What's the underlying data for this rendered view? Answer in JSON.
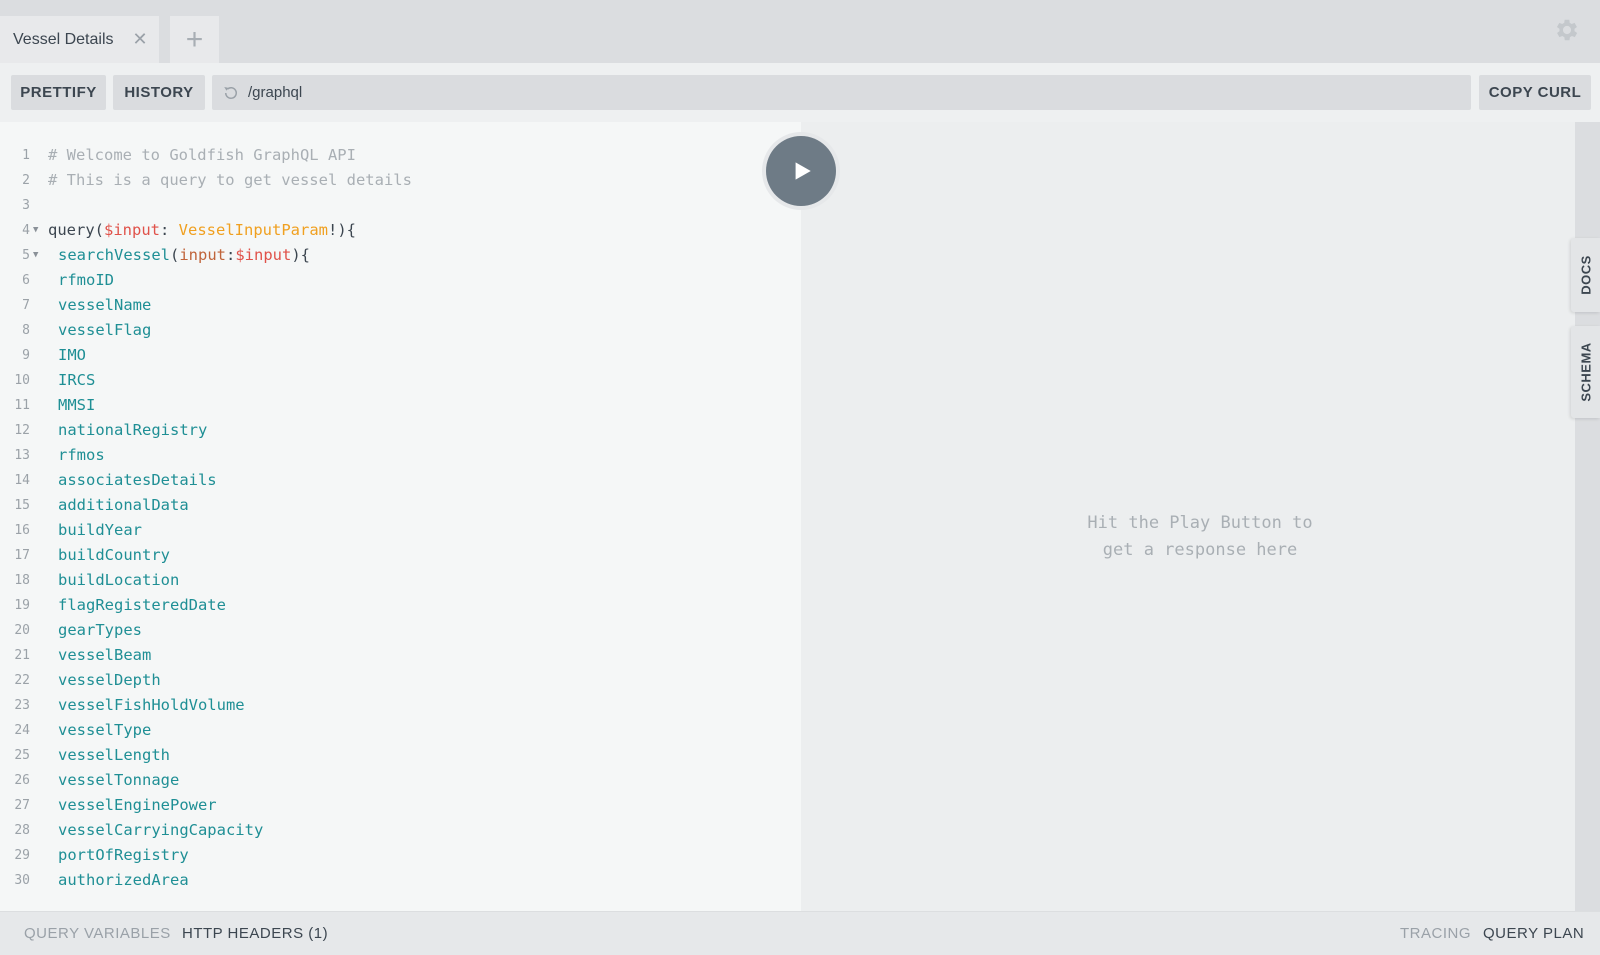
{
  "tabs": [
    {
      "label": "Vessel Details"
    }
  ],
  "toolbar": {
    "prettify_label": "PRETTIFY",
    "history_label": "HISTORY",
    "url": "/graphql",
    "copy_curl_label": "COPY CURL"
  },
  "editor": {
    "lines": [
      {
        "n": "1",
        "text": "# Welcome to Goldfish GraphQL API"
      },
      {
        "n": "2",
        "text": "# This is a query to get vessel details"
      },
      {
        "n": "3",
        "text": ""
      },
      {
        "n": "4",
        "text": "query($input: VesselInputParam!){"
      },
      {
        "n": "5",
        "text": "searchVessel(input:$input){"
      },
      {
        "n": "6",
        "text": "rfmoID"
      },
      {
        "n": "7",
        "text": "vesselName"
      },
      {
        "n": "8",
        "text": "vesselFlag"
      },
      {
        "n": "9",
        "text": "IMO"
      },
      {
        "n": "10",
        "text": "IRCS"
      },
      {
        "n": "11",
        "text": "MMSI"
      },
      {
        "n": "12",
        "text": "nationalRegistry"
      },
      {
        "n": "13",
        "text": "rfmos"
      },
      {
        "n": "14",
        "text": "associatesDetails"
      },
      {
        "n": "15",
        "text": "additionalData"
      },
      {
        "n": "16",
        "text": "buildYear"
      },
      {
        "n": "17",
        "text": "buildCountry"
      },
      {
        "n": "18",
        "text": "buildLocation"
      },
      {
        "n": "19",
        "text": "flagRegisteredDate"
      },
      {
        "n": "20",
        "text": "gearTypes"
      },
      {
        "n": "21",
        "text": "vesselBeam"
      },
      {
        "n": "22",
        "text": "vesselDepth"
      },
      {
        "n": "23",
        "text": "vesselFishHoldVolume"
      },
      {
        "n": "24",
        "text": "vesselType"
      },
      {
        "n": "25",
        "text": "vesselLength"
      },
      {
        "n": "26",
        "text": "vesselTonnage"
      },
      {
        "n": "27",
        "text": "vesselEnginePower"
      },
      {
        "n": "28",
        "text": "vesselCarryingCapacity"
      },
      {
        "n": "29",
        "text": "portOfRegistry"
      },
      {
        "n": "30",
        "text": "authorizedArea"
      }
    ]
  },
  "result": {
    "hint_line1": "Hit the Play Button to",
    "hint_line2": "get a response here"
  },
  "side_tabs": {
    "docs": "DOCS",
    "schema": "SCHEMA"
  },
  "bottom": {
    "query_variables": "QUERY VARIABLES",
    "http_headers": "HTTP HEADERS (1)",
    "tracing": "TRACING",
    "query_plan": "QUERY PLAN"
  },
  "icons": {
    "close_tab": "close-icon",
    "new_tab": "plus-icon",
    "settings": "gear-icon",
    "reload": "reload-icon",
    "play": "play-icon",
    "fold": "fold-arrow-icon"
  },
  "colors": {
    "comment": "#a9afb4",
    "variable": "#e0524a",
    "type": "#f0a020",
    "field": "#1f8f95",
    "argument": "#c0643a",
    "play_button": "#6e7b86"
  }
}
